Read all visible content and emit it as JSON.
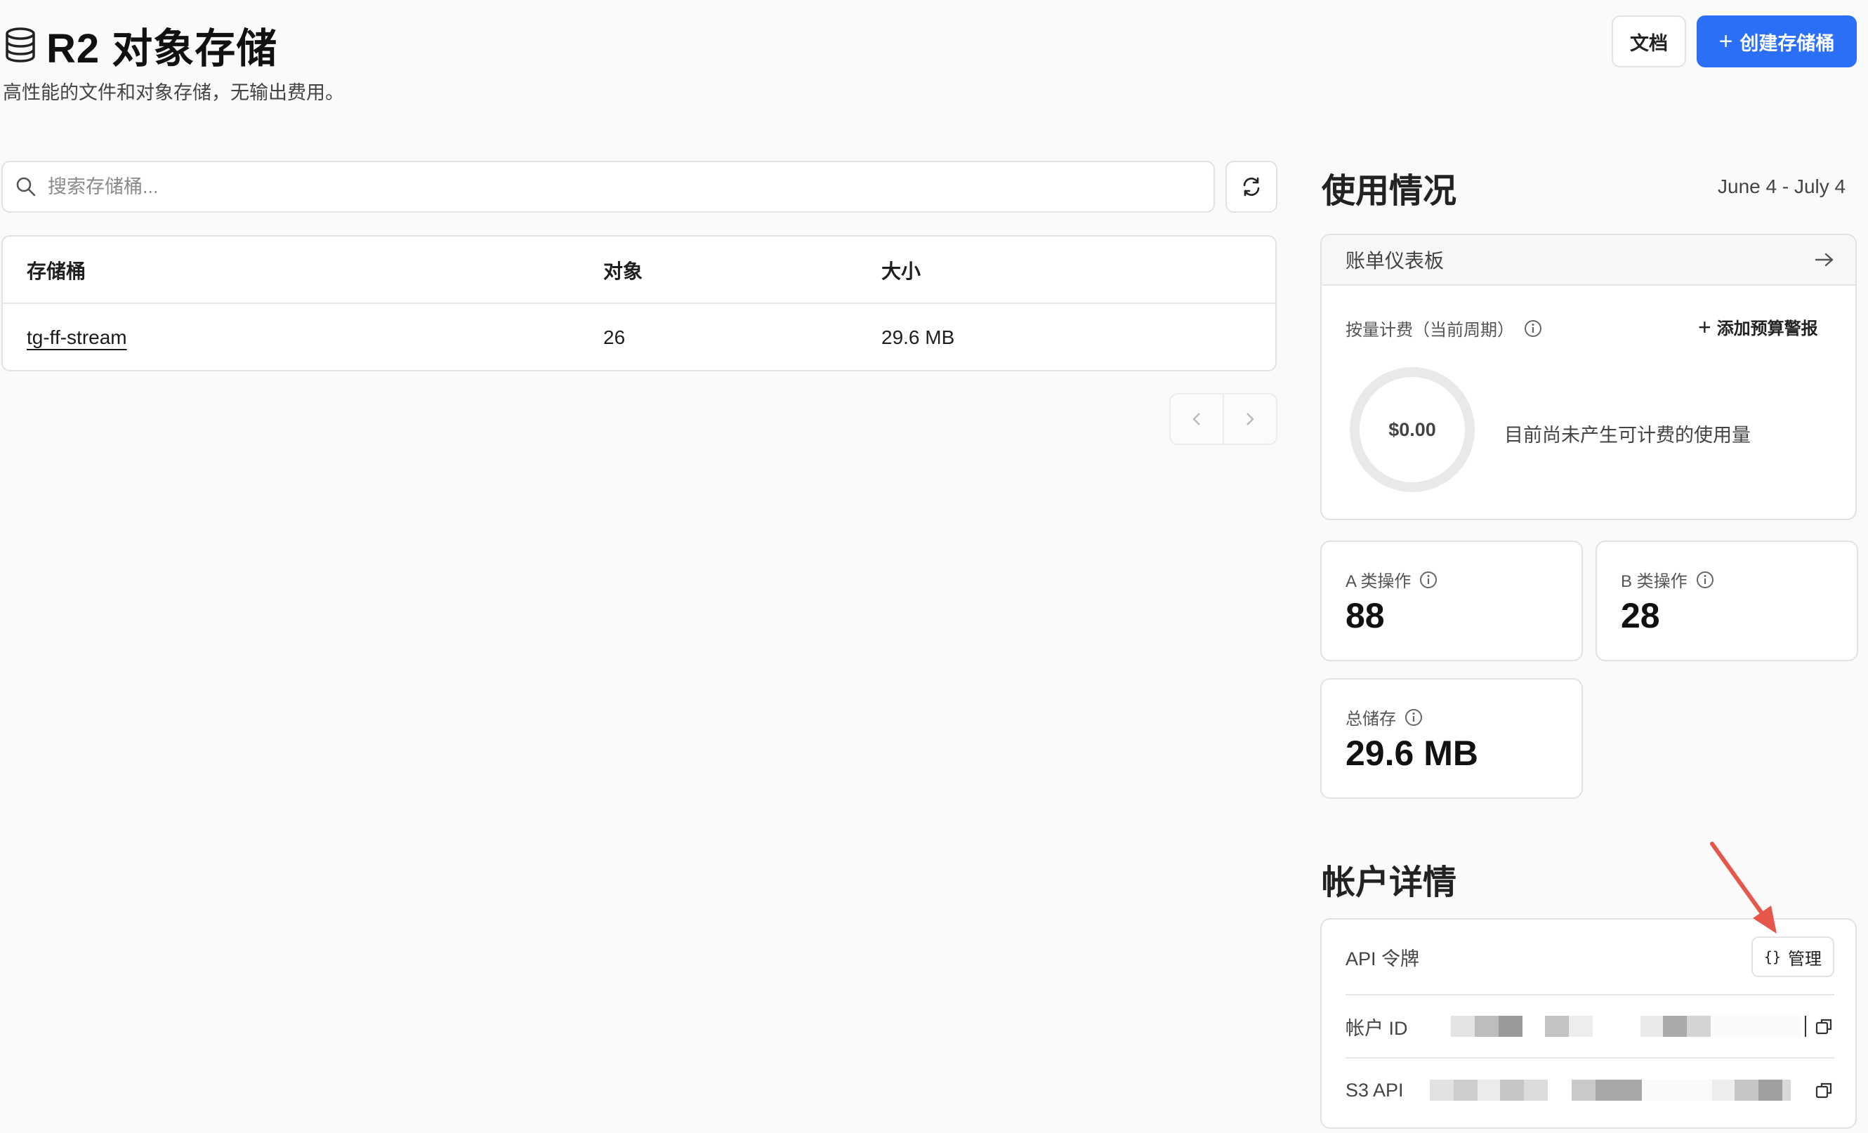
{
  "header": {
    "title": "R2 对象存储",
    "subtitle": "高性能的文件和对象存储，无输出费用。",
    "docs_label": "文档",
    "create_label": "创建存储桶"
  },
  "search": {
    "placeholder": "搜索存储桶..."
  },
  "table": {
    "headers": [
      "存储桶",
      "对象",
      "大小"
    ],
    "rows": [
      {
        "name": "tg-ff-stream",
        "objects": "26",
        "size": "29.6 MB"
      }
    ]
  },
  "usage": {
    "title": "使用情况",
    "date_range": "June 4 - July 4",
    "billing_dashboard_label": "账单仪表板",
    "metered_label": "按量计费（当前周期）",
    "add_alert_label": "添加预算警报",
    "amount": "$0.00",
    "no_usage_text": "目前尚未产生可计费的使用量",
    "class_a_label": "A 类操作",
    "class_a_value": "88",
    "class_b_label": "B 类操作",
    "class_b_value": "28",
    "storage_label": "总储存",
    "storage_value": "29.6 MB"
  },
  "account": {
    "title": "帐户详情",
    "api_token_label": "API 令牌",
    "manage_label": "管理",
    "account_id_label": "帐户 ID",
    "s3_api_label": "S3 API"
  },
  "colors": {
    "primary": "#2a6ff5",
    "annotation_arrow": "#e4574a"
  }
}
